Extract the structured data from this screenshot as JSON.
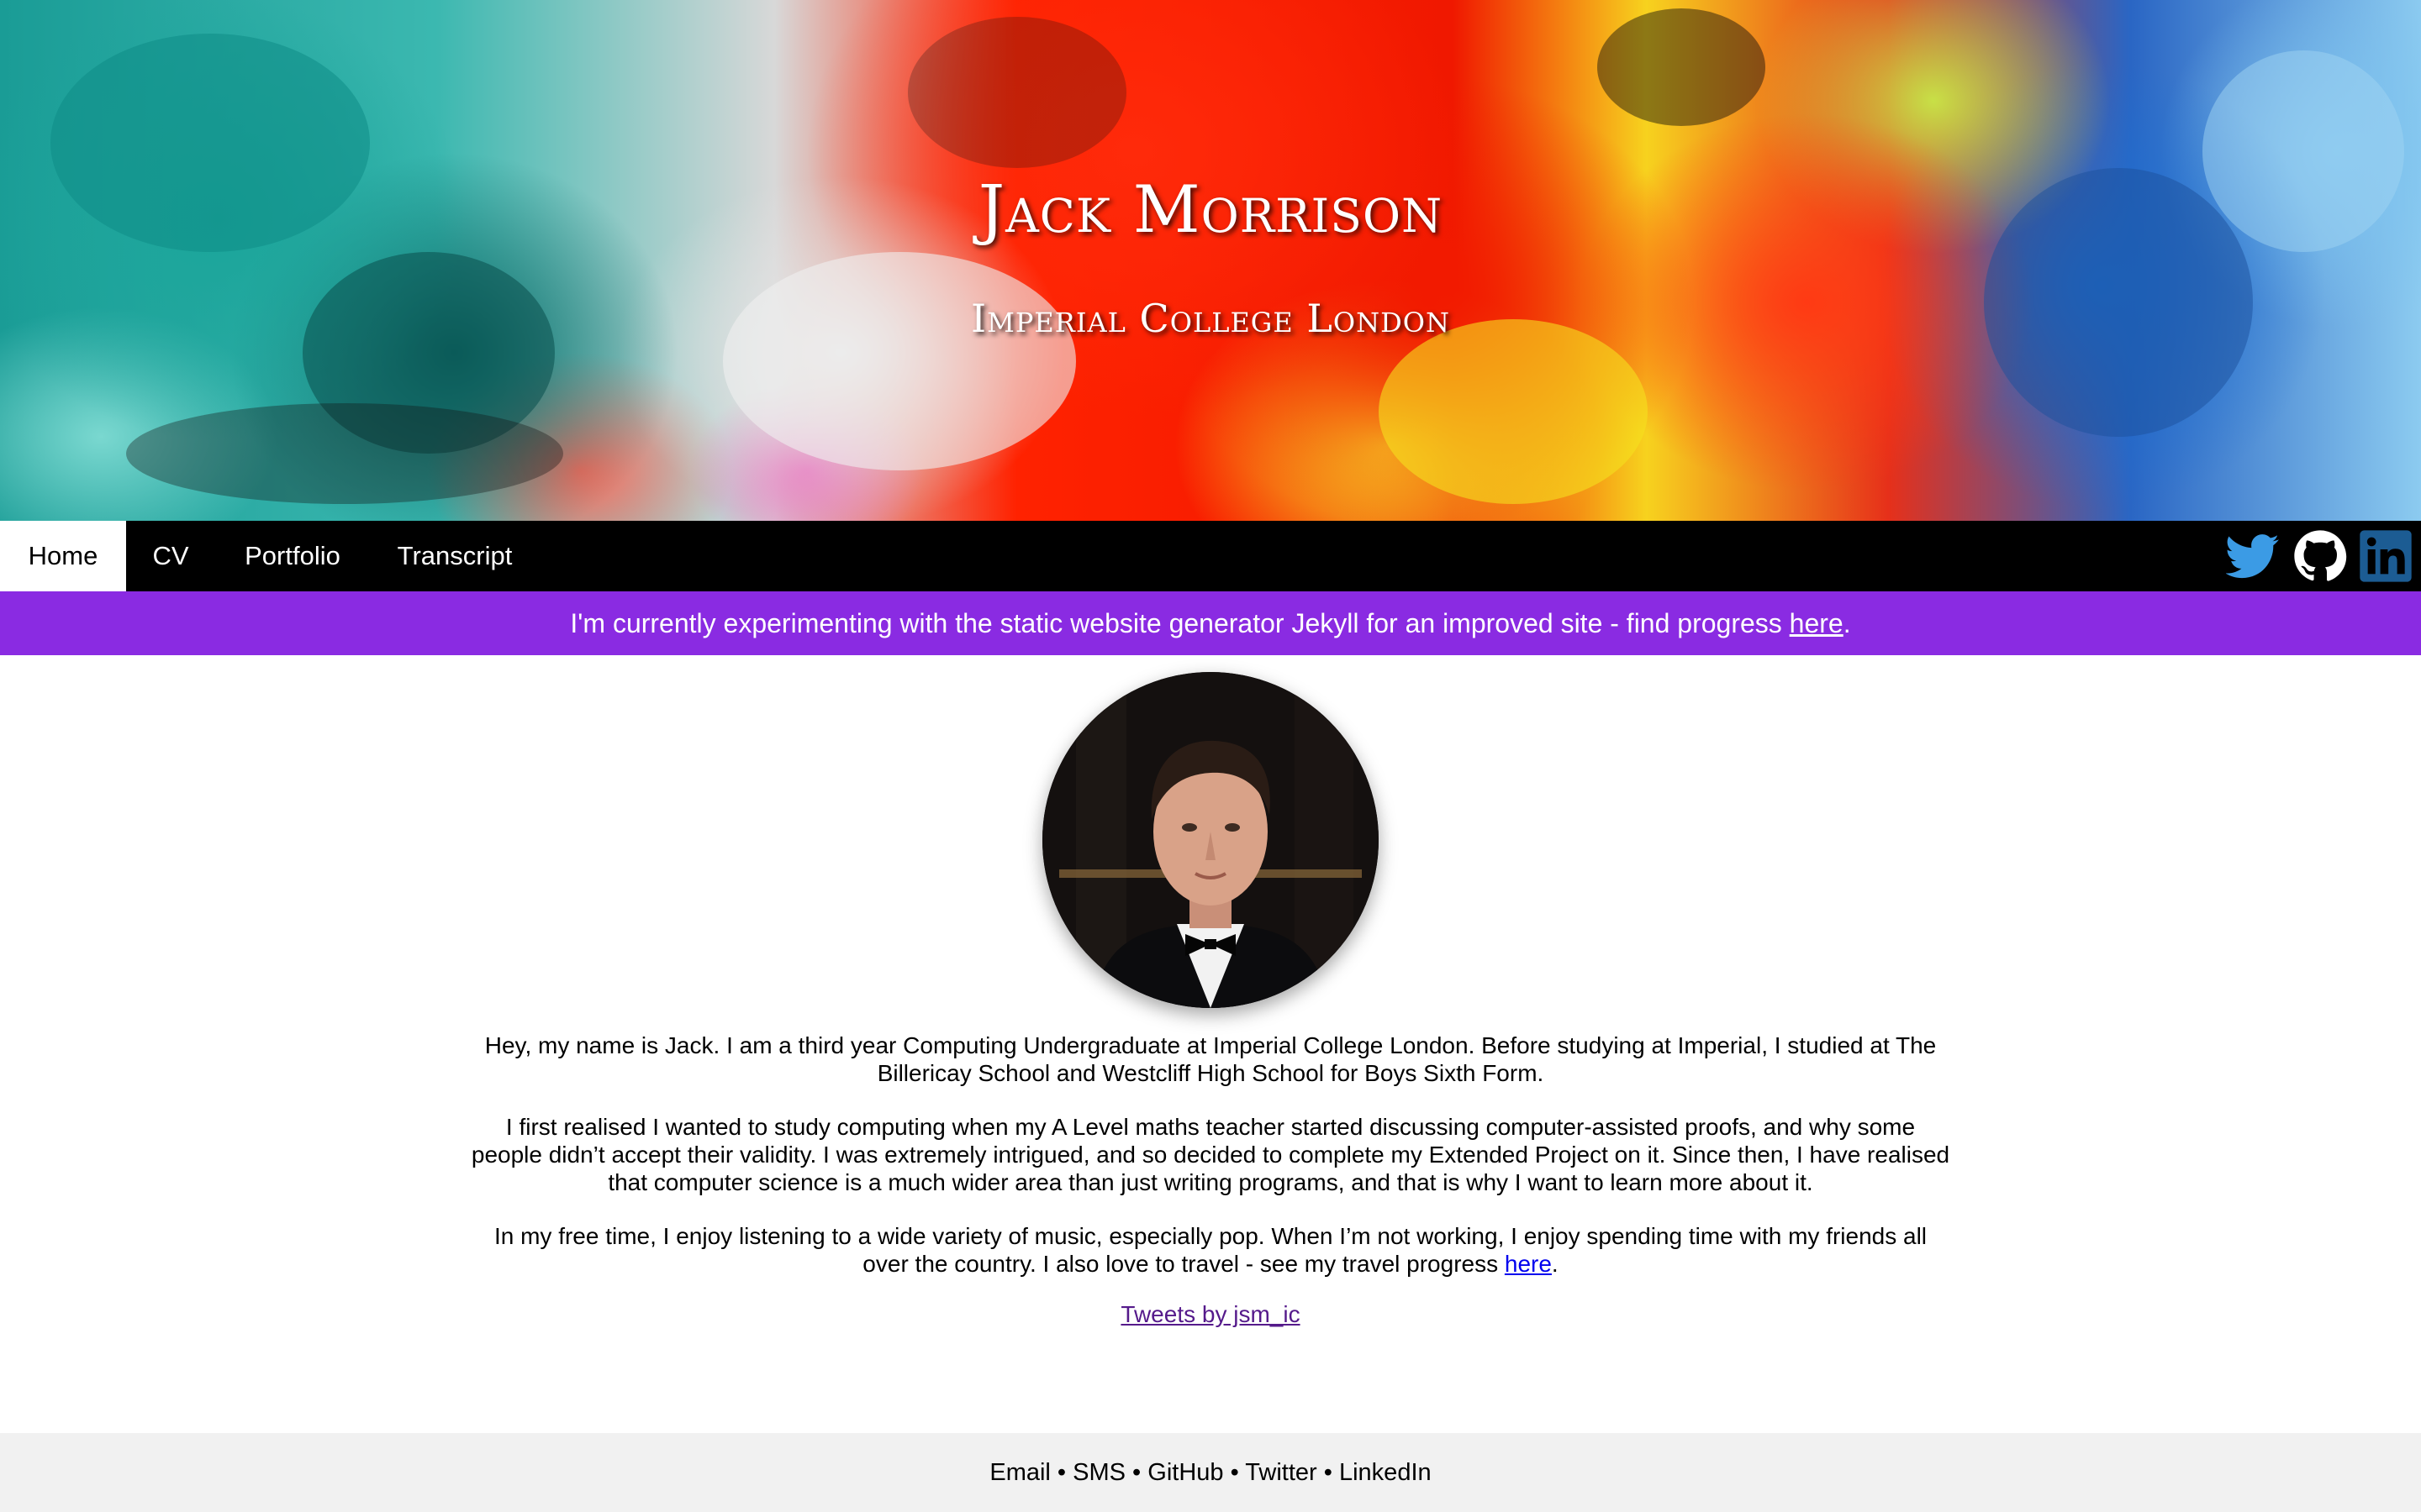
{
  "header": {
    "name": "Jack Morrison",
    "subtitle": "Imperial College London"
  },
  "nav": {
    "items": [
      {
        "label": "Home",
        "active": true
      },
      {
        "label": "CV",
        "active": false
      },
      {
        "label": "Portfolio",
        "active": false
      },
      {
        "label": "Transcript",
        "active": false
      }
    ],
    "social": [
      {
        "name": "twitter-icon",
        "color": "#3b9be5"
      },
      {
        "name": "github-icon",
        "color": "#ffffff"
      },
      {
        "name": "linkedin-icon",
        "color": "#1c5c93"
      }
    ]
  },
  "notice": {
    "text": "I'm currently experimenting with the static website generator Jekyll for an improved site - find progress ",
    "link": "here",
    "suffix": ".",
    "background": "#8a2be2"
  },
  "main": {
    "paragraphs": [
      "Hey, my name is Jack. I am a third year Computing Undergraduate at Imperial College London. Before studying at Imperial, I studied at The Billericay School and Westcliff High School for Boys Sixth Form.",
      "I first realised I wanted to study computing when my A Level maths teacher started discussing computer-assisted proofs, and why some people didn’t accept their validity. I was extremely intrigued, and so decided to complete my Extended Project on it. Since then, I have realised that computer science is a much wider area than just writing programs, and that is why I want to learn more about it."
    ],
    "free_time": {
      "text": "In my free time, I enjoy listening to a wide variety of music, especially pop. When I’m not working, I enjoy spending time with my friends all over the country. I also love to travel - see my travel progress ",
      "link": "here",
      "suffix": "."
    },
    "tweets_link": "Tweets by jsm_ic"
  },
  "footer": {
    "links": [
      "Email",
      "SMS",
      "GitHub",
      "Twitter",
      "LinkedIn"
    ],
    "separator": " • "
  }
}
